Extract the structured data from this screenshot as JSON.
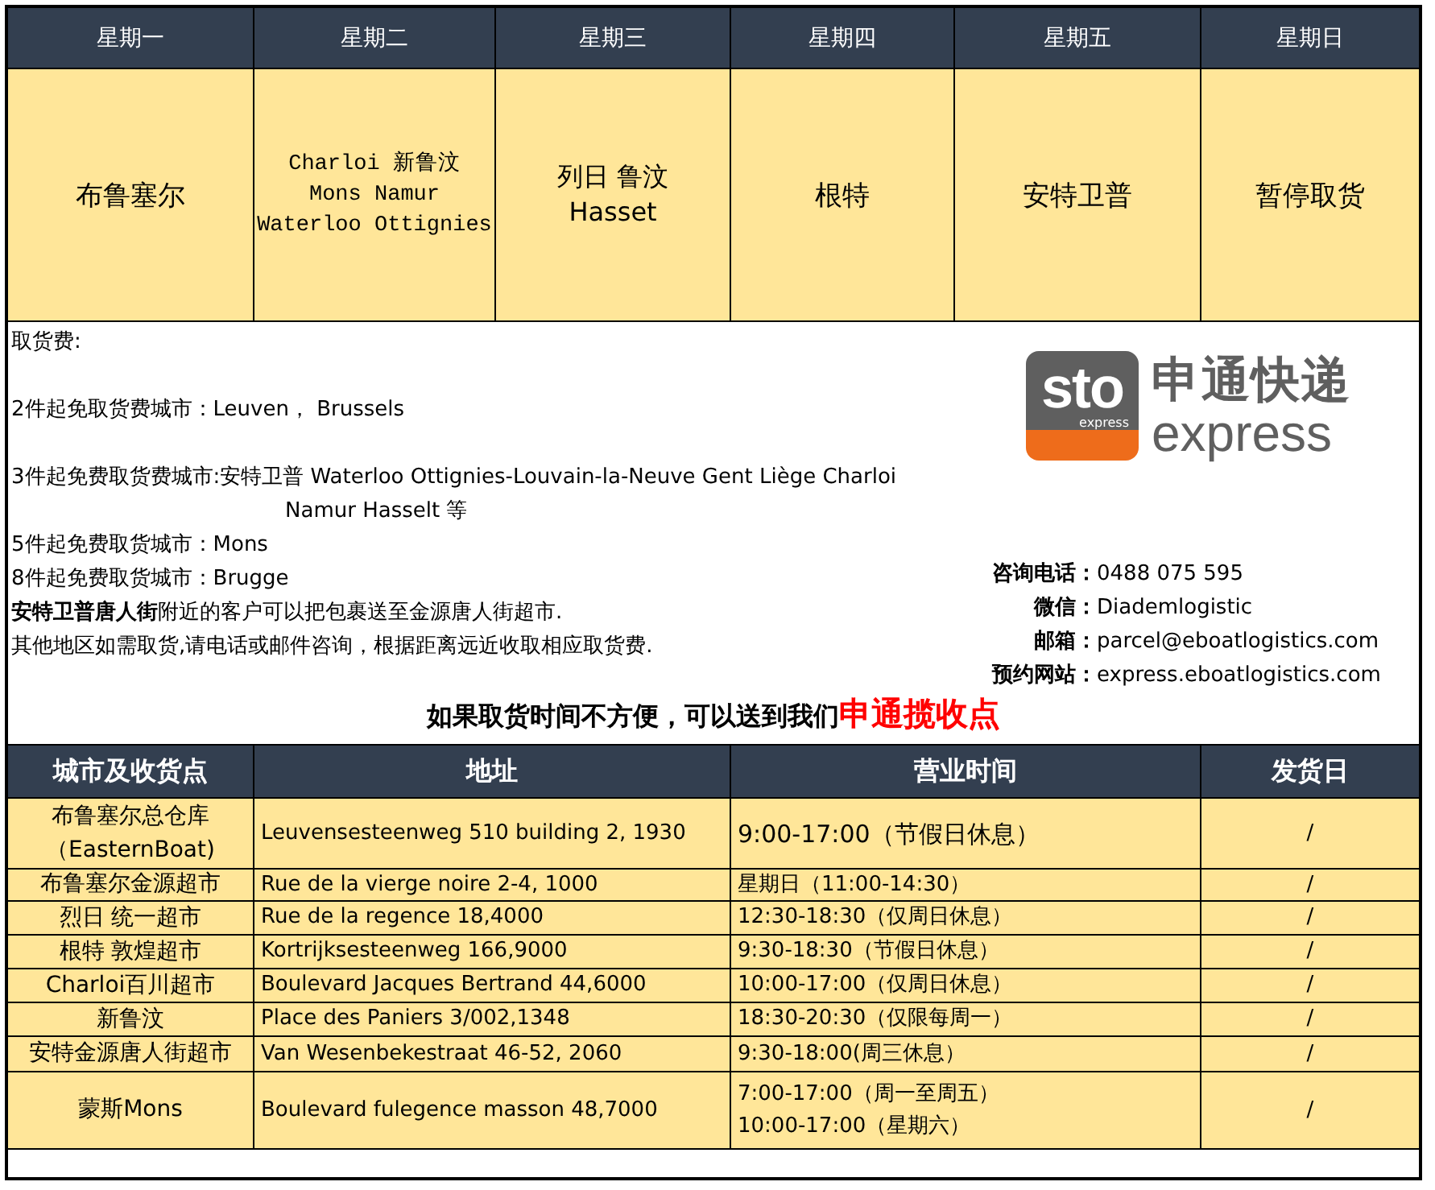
{
  "schedule": {
    "columns": [
      "星期一",
      "星期二",
      "星期三",
      "星期四",
      "星期五",
      "星期日"
    ],
    "cells": [
      [
        "布鲁塞尔"
      ],
      [
        "Charloi 新鲁汶",
        "Mons Namur",
        "Waterloo Ottignies"
      ],
      [
        "列日 鲁汶",
        "Hasset"
      ],
      [
        "根特"
      ],
      [
        "安特卫普"
      ],
      [
        "暂停取货"
      ]
    ]
  },
  "fees": {
    "title": "取货费:",
    "items": [
      {
        "lines": [
          "2件起免取货费城市：Leuven， Brussels"
        ]
      },
      {
        "lines": [
          "3件起免费取货费城市:安特卫普  Waterloo Ottignies-Louvain-la-Neuve  Gent  Liège  Charloi",
          "Namur Hasselt  等"
        ]
      },
      {
        "lines": [
          "5件起免费取货城市：Mons"
        ]
      },
      {
        "lines": [
          "8件起免费取货城市：Brugge"
        ]
      },
      {
        "lines": [
          "**安特卫普唐人街**附近的客户可以把包裹送至金源唐人街超市."
        ]
      },
      {
        "lines": [
          "其他地区如需取货,请电话或邮件咨询，根据距离远近收取相应取货费."
        ]
      }
    ]
  },
  "logo": {
    "mark": "sto",
    "mark_sub": "express",
    "name": "申通快递",
    "name_sub": "express"
  },
  "contacts": [
    {
      "label": "咨询电话：",
      "value": "0488 075 595"
    },
    {
      "label": "微信：",
      "value": "Diademlogistic"
    },
    {
      "label": "邮箱：",
      "value": "parcel@eboatlogistics.com"
    },
    {
      "label": "预约网站：",
      "value": "express.eboatlogistics.com"
    }
  ],
  "notice": {
    "text": "如果取货时间不方便，可以送到我们",
    "highlight": "申通揽收点"
  },
  "points": {
    "columns": [
      "城市及收货点",
      "地址",
      "营业时间",
      "发货日"
    ],
    "rows": [
      {
        "name": [
          "布鲁塞尔总仓库",
          "（EasternBoat)"
        ],
        "address": "Leuvensesteenweg 510 building 2, 1930",
        "hours": [
          "9:00-17:00（节假日休息）"
        ],
        "ship_day": "/"
      },
      {
        "name": [
          "布鲁塞尔金源超市"
        ],
        "address": "Rue de la vierge noire 2-4, 1000",
        "hours": [
          "星期日（11:00-14:30）"
        ],
        "ship_day": "/"
      },
      {
        "name": [
          "烈日 统一超市"
        ],
        "address": "Rue de la regence 18,4000",
        "hours": [
          "12:30-18:30（仅周日休息）"
        ],
        "ship_day": "/"
      },
      {
        "name": [
          "根特 敦煌超市"
        ],
        "address": "Kortrijksesteenweg 166,9000",
        "hours": [
          "9:30-18:30（节假日休息）"
        ],
        "ship_day": "/"
      },
      {
        "name": [
          "Charloi百川超市"
        ],
        "address": "Boulevard Jacques Bertrand 44,6000",
        "hours": [
          "10:00-17:00（仅周日休息）"
        ],
        "ship_day": "/"
      },
      {
        "name": [
          "新鲁汶"
        ],
        "address": "Place des Paniers 3/002,1348",
        "hours": [
          "18:30-20:30（仅限每周一）"
        ],
        "ship_day": "/"
      },
      {
        "name": [
          "安特金源唐人街超市"
        ],
        "address": "Van Wesenbekestraat 46-52, 2060",
        "hours": [
          "9:30-18:00(周三休息）"
        ],
        "ship_day": "/"
      },
      {
        "name": [
          "蒙斯Mons"
        ],
        "address": "Boulevard fulegence masson 48,7000",
        "hours": [
          "7:00-17:00（周一至周五）",
          "10:00-17:00（星期六）"
        ],
        "ship_day": "/"
      }
    ]
  }
}
